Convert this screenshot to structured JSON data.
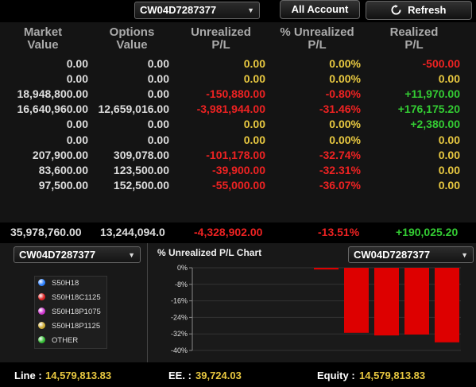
{
  "toolbar": {
    "account_select": "CW04D7287377",
    "all_account_label": "All Account",
    "refresh_label": "Refresh"
  },
  "table": {
    "headers": [
      [
        "Market",
        "Value"
      ],
      [
        "Options",
        "Value"
      ],
      [
        "Unrealized",
        "P/L"
      ],
      [
        "% Unrealized",
        "P/L"
      ],
      [
        "Realized",
        "P/L"
      ]
    ],
    "rows": [
      {
        "market": "0.00",
        "options": "0.00",
        "unrealized": "0.00",
        "pct": "0.00%",
        "realized": "-500.00"
      },
      {
        "market": "0.00",
        "options": "0.00",
        "unrealized": "0.00",
        "pct": "0.00%",
        "realized": "0.00"
      },
      {
        "market": "18,948,800.00",
        "options": "0.00",
        "unrealized": "-150,880.00",
        "pct": "-0.80%",
        "realized": "+11,970.00"
      },
      {
        "market": "16,640,960.00",
        "options": "12,659,016.00",
        "unrealized": "-3,981,944.00",
        "pct": "-31.46%",
        "realized": "+176,175.20"
      },
      {
        "market": "0.00",
        "options": "0.00",
        "unrealized": "0.00",
        "pct": "0.00%",
        "realized": "+2,380.00"
      },
      {
        "market": "0.00",
        "options": "0.00",
        "unrealized": "0.00",
        "pct": "0.00%",
        "realized": "0.00"
      },
      {
        "market": "207,900.00",
        "options": "309,078.00",
        "unrealized": "-101,178.00",
        "pct": "-32.74%",
        "realized": "0.00"
      },
      {
        "market": "83,600.00",
        "options": "123,500.00",
        "unrealized": "-39,900.00",
        "pct": "-32.31%",
        "realized": "0.00"
      },
      {
        "market": "97,500.00",
        "options": "152,500.00",
        "unrealized": "-55,000.00",
        "pct": "-36.07%",
        "realized": "0.00"
      }
    ],
    "totals": {
      "market": "35,978,760.00",
      "options": "13,244,094.0",
      "unrealized": "-4,328,902.00",
      "pct": "-13.51%",
      "realized": "+190,025.20"
    }
  },
  "bottom": {
    "left_select": "CW04D7287377",
    "chart_title": "% Unrealized P/L Chart",
    "right_select": "CW04D7287377",
    "legend": [
      {
        "label": "S50H18",
        "color": "#2a7fff"
      },
      {
        "label": "S50H18C1125",
        "color": "#dd2222"
      },
      {
        "label": "S50H18P1075",
        "color": "#cc33cc"
      },
      {
        "label": "S50H18P1125",
        "color": "#ccaa33"
      },
      {
        "label": "OTHER",
        "color": "#33bb33"
      }
    ]
  },
  "chart_data": {
    "type": "bar",
    "title": "% Unrealized P/L Chart",
    "ylim": [
      -40,
      0
    ],
    "yticks": [
      "0%",
      "-8%",
      "-16%",
      "-24%",
      "-32%",
      "-40%"
    ],
    "values": [
      -0.8,
      -31.46,
      -32.74,
      -32.31,
      -36.07
    ],
    "bar_color": "#dd0000"
  },
  "footer": {
    "line_label": "Line :",
    "line_value": "14,579,813.83",
    "ee_label": "EE. :",
    "ee_value": "39,724.03",
    "equity_label": "Equity :",
    "equity_value": "14,579,813.83"
  }
}
